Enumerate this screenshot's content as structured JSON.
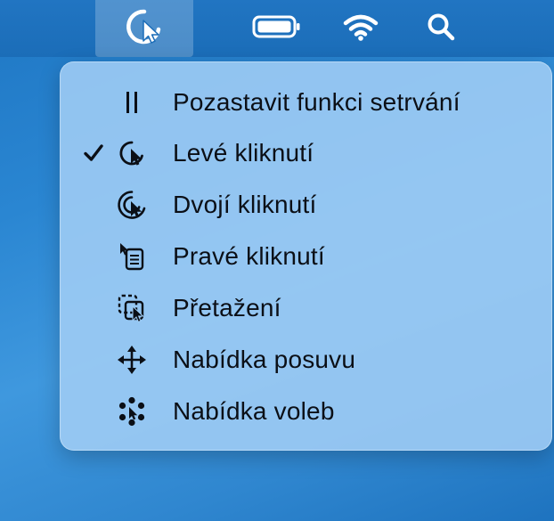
{
  "menubar": {
    "icons": [
      "pointer-click-icon",
      "battery-icon",
      "wifi-icon",
      "search-icon"
    ]
  },
  "menu": {
    "items": [
      {
        "label": "Pozastavit funkci setrvání",
        "icon": "pause-icon",
        "checked": false
      },
      {
        "label": "Levé kliknutí",
        "icon": "left-click-icon",
        "checked": true
      },
      {
        "label": "Dvojí kliknutí",
        "icon": "double-click-icon",
        "checked": false
      },
      {
        "label": "Pravé kliknutí",
        "icon": "right-click-icon",
        "checked": false
      },
      {
        "label": "Přetažení",
        "icon": "drag-icon",
        "checked": false
      },
      {
        "label": "Nabídka posuvu",
        "icon": "scroll-menu-icon",
        "checked": false
      },
      {
        "label": "Nabídka voleb",
        "icon": "options-menu-icon",
        "checked": false
      }
    ]
  },
  "colors": {
    "desktop": "#2a86d2",
    "menubar": "#1b6db8",
    "menu_background": "#a0cdf5",
    "text": "#0b0f16"
  }
}
